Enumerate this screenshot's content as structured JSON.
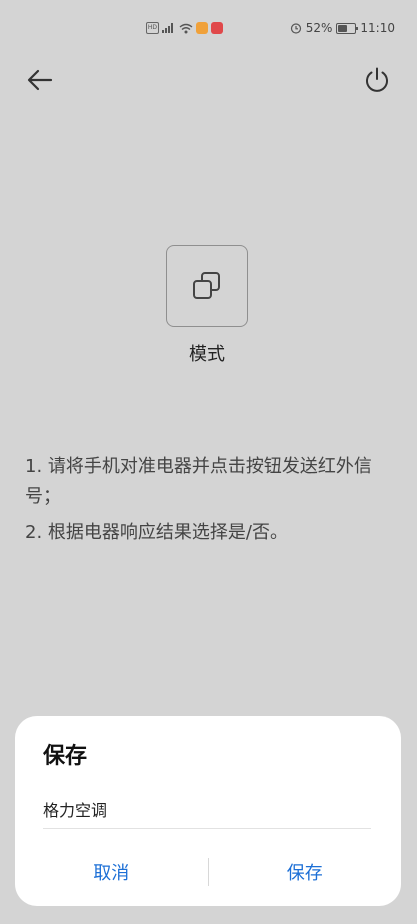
{
  "status_bar": {
    "battery_percent": "52%",
    "time": "11:10",
    "battery_level": 0.52
  },
  "header": {
    "back_icon": "arrow-left-icon",
    "power_icon": "power-icon"
  },
  "mode": {
    "icon": "mode-icon",
    "label": "模式"
  },
  "instructions": [
    "1. 请将手机对准电器并点击按钮发送红外信号；",
    "2. 根据电器响应结果选择是/否。"
  ],
  "dialog": {
    "title": "保存",
    "input_value": "格力空调",
    "cancel_label": "取消",
    "save_label": "保存",
    "accent_color": "#1c6fd6"
  }
}
